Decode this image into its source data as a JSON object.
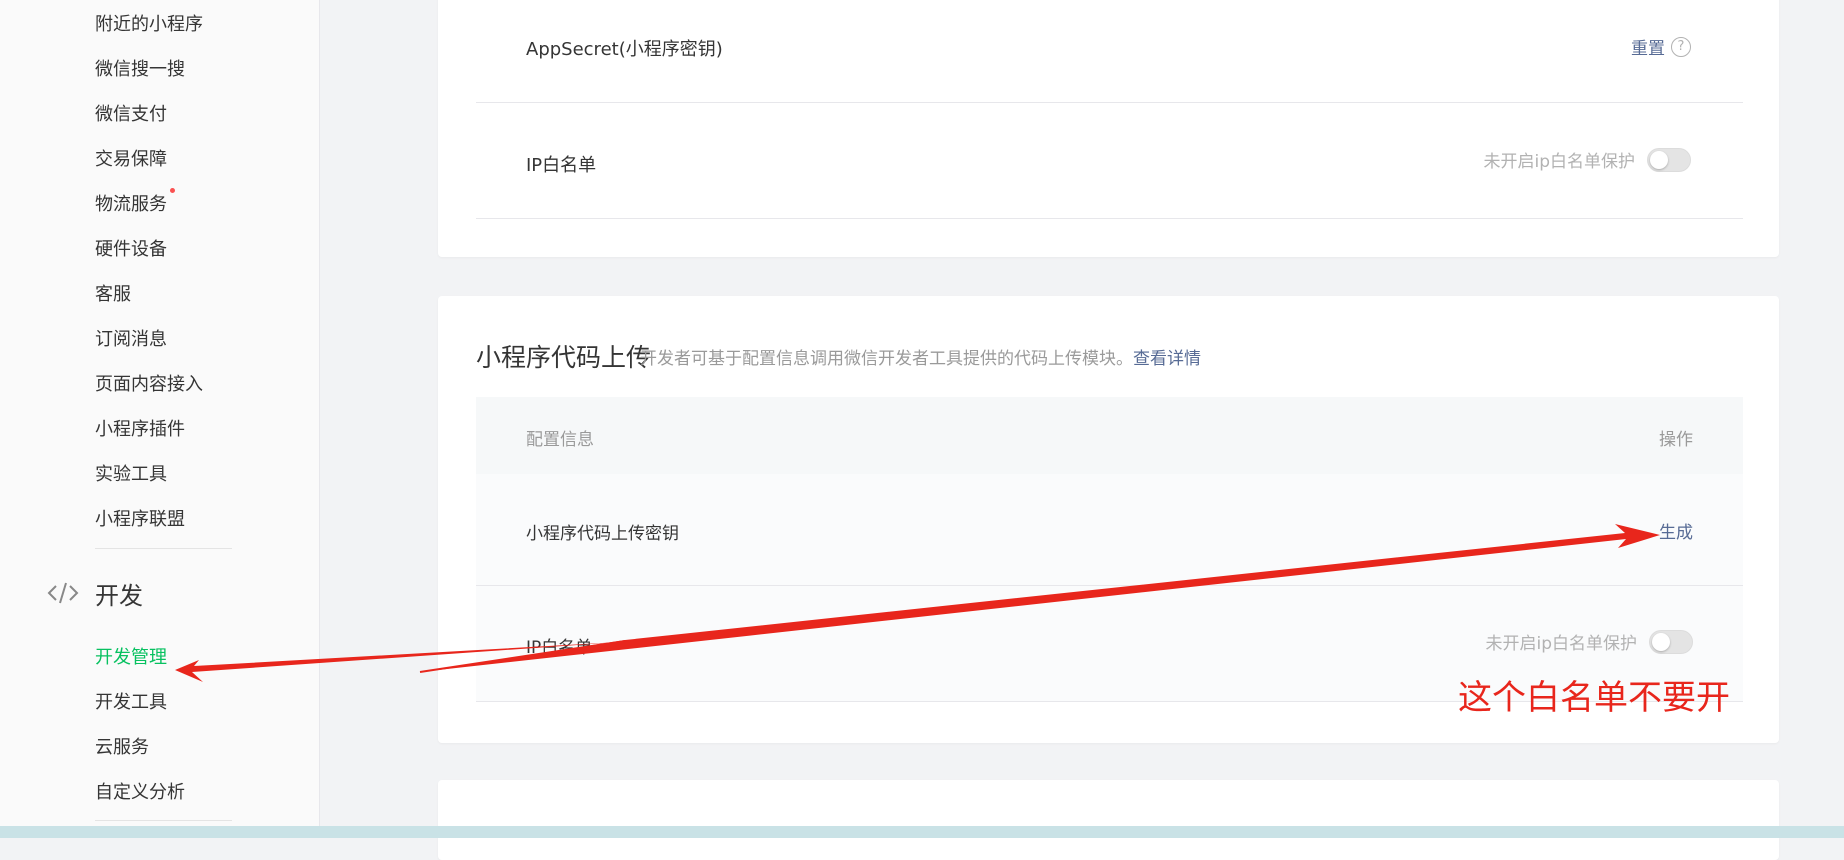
{
  "sidebar": {
    "items": [
      {
        "label": "附近的小程序"
      },
      {
        "label": "微信搜一搜"
      },
      {
        "label": "微信支付"
      },
      {
        "label": "交易保障"
      },
      {
        "label": "物流服务"
      },
      {
        "label": "硬件设备"
      },
      {
        "label": "客服"
      },
      {
        "label": "订阅消息"
      },
      {
        "label": "页面内容接入"
      },
      {
        "label": "小程序插件"
      },
      {
        "label": "实验工具"
      },
      {
        "label": "小程序联盟"
      }
    ],
    "dev_group": {
      "label": "开发",
      "items": [
        {
          "label": "开发管理",
          "active": true
        },
        {
          "label": "开发工具"
        },
        {
          "label": "云服务"
        },
        {
          "label": "自定义分析"
        }
      ]
    }
  },
  "config_card": {
    "appsecret_label": "AppSecret(小程序密钥)",
    "appsecret_action": "重置",
    "ip_label": "IP白名单",
    "ip_status": "未开启ip白名单保护"
  },
  "upload_card": {
    "title": "小程序代码上传",
    "desc": "开发者可基于配置信息调用微信开发者工具提供的代码上传模块。",
    "desc_link": "查看详情",
    "table": {
      "col_config": "配置信息",
      "col_action": "操作"
    },
    "key_label": "小程序代码上传密钥",
    "key_action": "生成",
    "ip_label": "IP白名单",
    "ip_status": "未开启ip白名单保护"
  },
  "annotation": {
    "text": "这个白名单不要开",
    "color": "#e8261c"
  },
  "colors": {
    "accent_green": "#07c160",
    "link_blue": "#576b95"
  }
}
